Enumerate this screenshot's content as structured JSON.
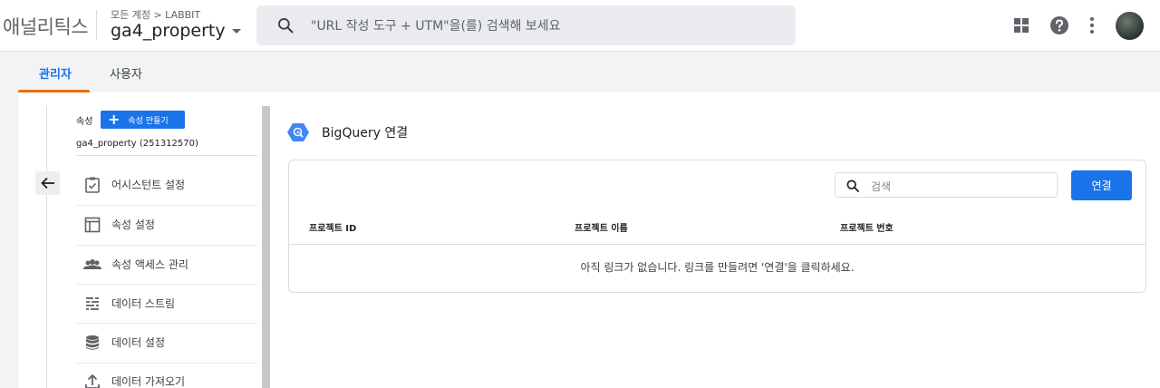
{
  "app": {
    "name": "애널리틱스"
  },
  "header": {
    "breadcrumb": "모든 계정 > LABBIT",
    "property_name": "ga4_property",
    "search_placeholder": "\"URL 작성 도구 + UTM\"을(를) 검색해 보세요"
  },
  "tabs": [
    {
      "label": "관리자",
      "active": true
    },
    {
      "label": "사용자",
      "active": false
    }
  ],
  "sidebar": {
    "section_label": "속성",
    "create_button": "속성 만들기",
    "property_id": "ga4_property (251312570)",
    "items": [
      {
        "label": "어시스턴트 설정",
        "icon": "clipboard-check-icon"
      },
      {
        "label": "속성 설정",
        "icon": "layout-icon"
      },
      {
        "label": "속성 액세스 관리",
        "icon": "people-icon"
      },
      {
        "label": "데이터 스트림",
        "icon": "streams-icon"
      },
      {
        "label": "데이터 설정",
        "icon": "database-icon"
      },
      {
        "label": "데이터 가져오기",
        "icon": "upload-icon"
      }
    ]
  },
  "main": {
    "title": "BigQuery 연결",
    "search_placeholder": "검색",
    "connect_button": "연결",
    "columns": [
      "프로젝트 ID",
      "프로젝트 이름",
      "프로젝트 번호"
    ],
    "empty_message": "아직 링크가 없습니다. 링크를 만들려면 '연결'을 클릭하세요."
  },
  "colors": {
    "accent": "#1a73e8",
    "tab_underline": "#e8710a"
  }
}
